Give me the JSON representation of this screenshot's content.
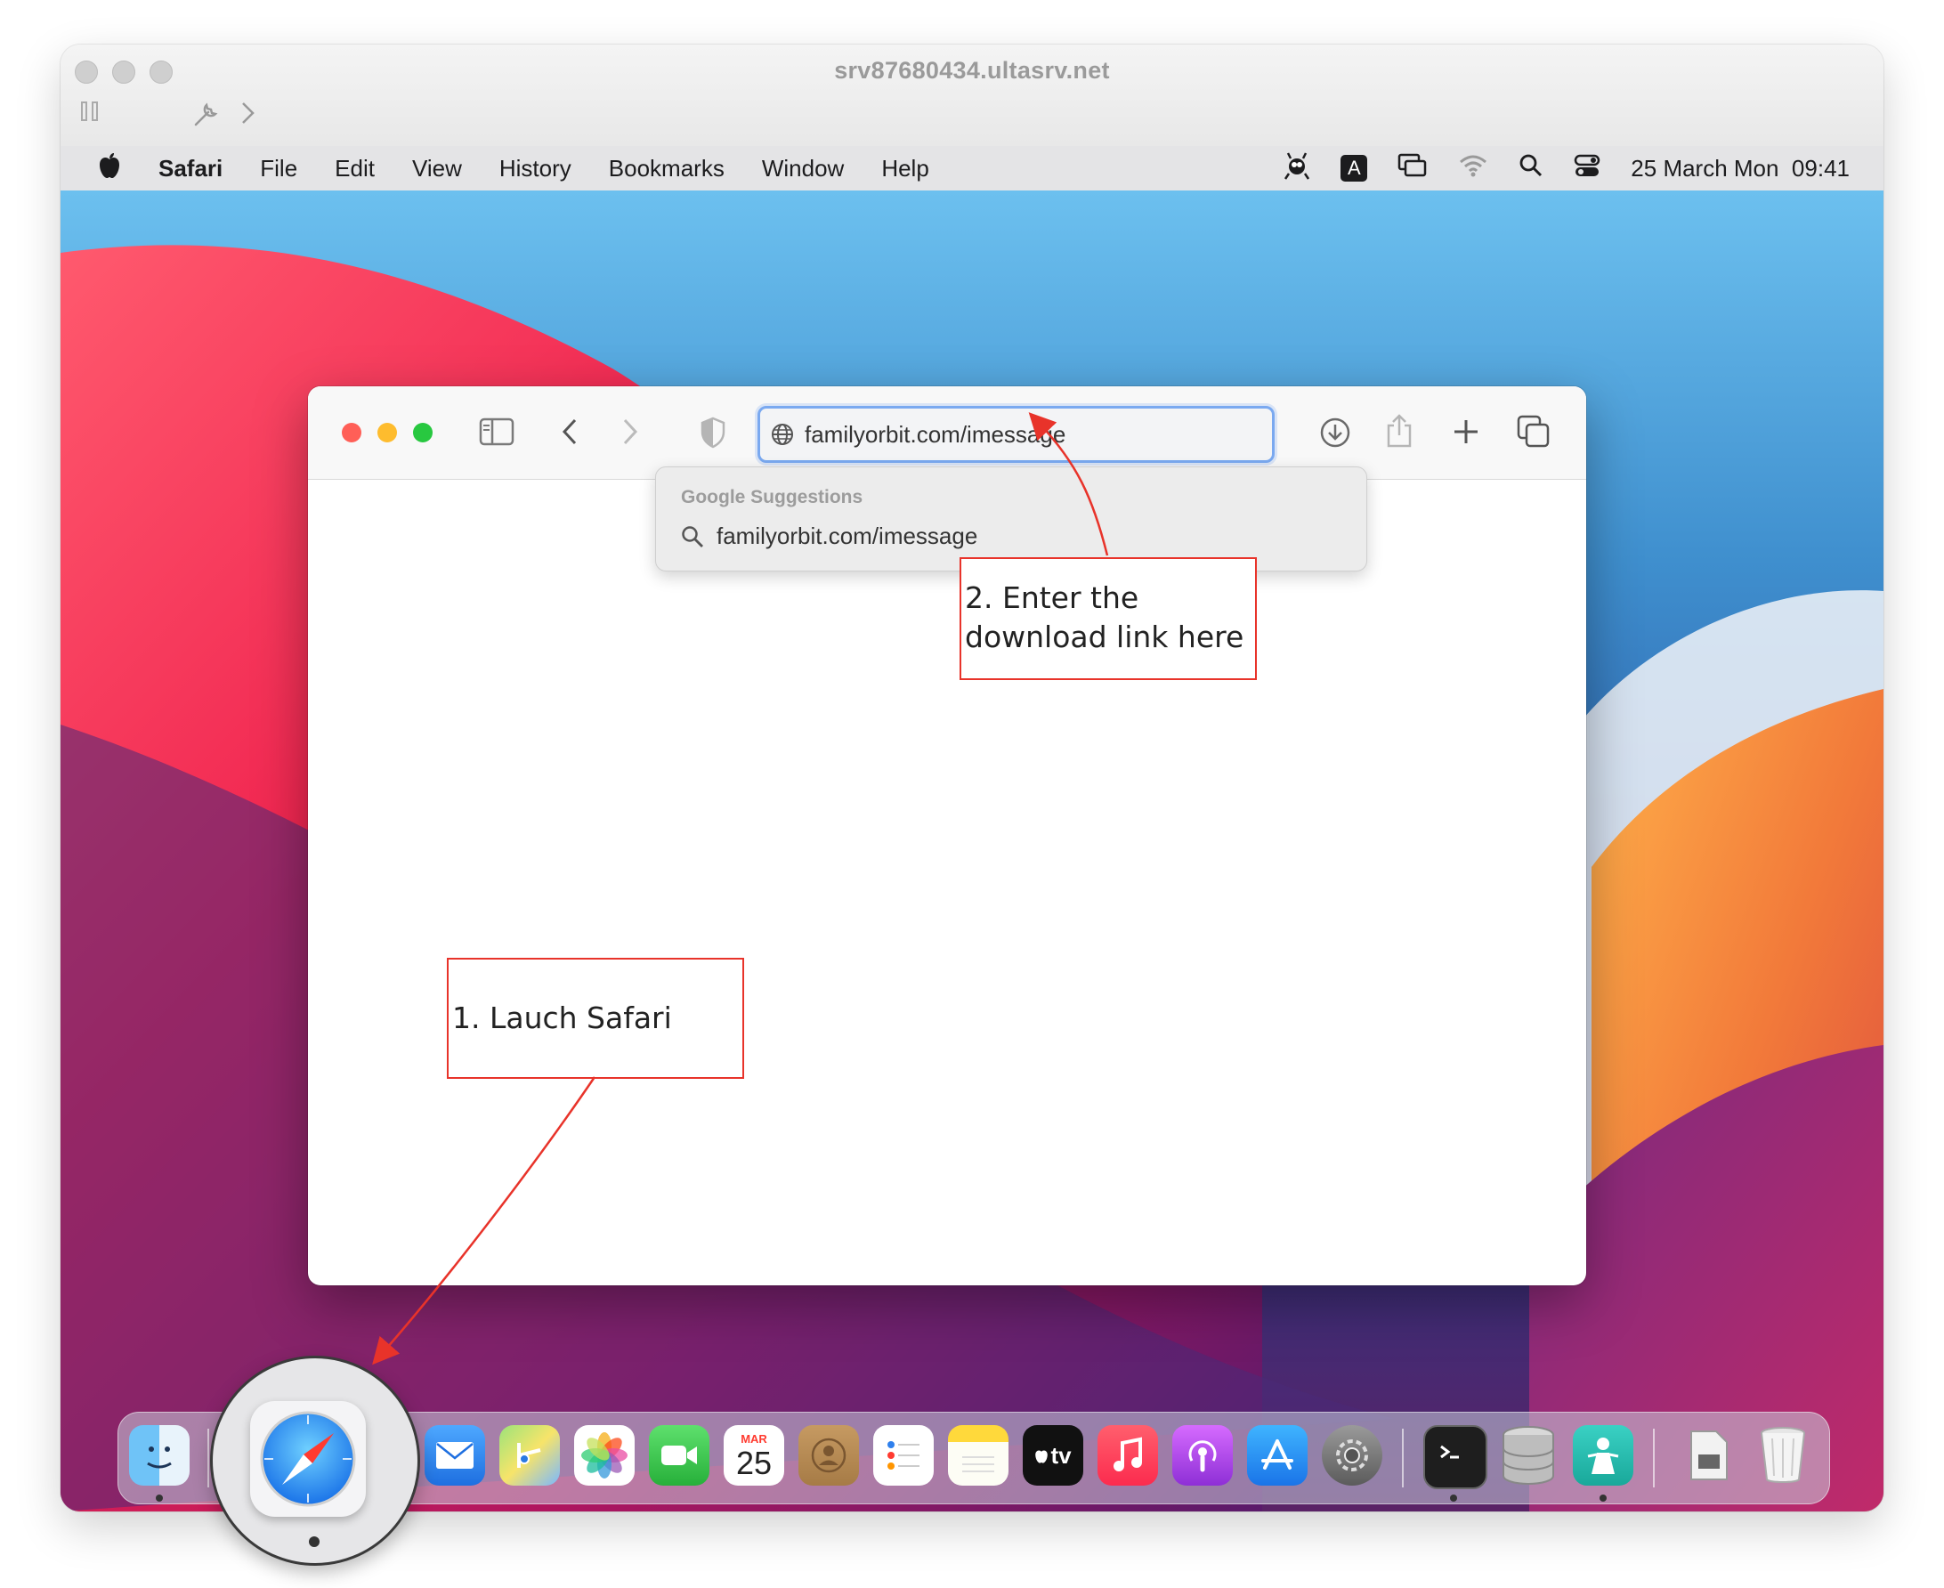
{
  "vm_window": {
    "title": "srv87680434.ultasrv.net"
  },
  "menubar": {
    "apple": "",
    "items": [
      "Safari",
      "File",
      "Edit",
      "View",
      "History",
      "Bookmarks",
      "Window",
      "Help"
    ],
    "status_icons": [
      "bug-icon",
      "input-source-icon",
      "screen-mirroring-icon",
      "wifi-icon",
      "search-icon",
      "control-center-icon"
    ],
    "input_source_label": "A",
    "clock": "25 March Mon  09:41"
  },
  "safari": {
    "url_value": "familyorbit.com/imessage",
    "suggestions": {
      "header": "Google Suggestions",
      "items": [
        "familyorbit.com/imessage"
      ]
    }
  },
  "annotations": {
    "step1": "1. Lauch Safari",
    "step2_line1": "2. Enter the",
    "step2_line2": "download link here",
    "arrow_color": "#e8332a"
  },
  "dock": {
    "calendar_month": "MAR",
    "calendar_day": "25",
    "tv_label": "tv",
    "apps": [
      "finder-icon",
      "safari-icon",
      "messages-icon",
      "mail-icon",
      "maps-icon",
      "photos-icon",
      "facetime-icon",
      "calendar-icon",
      "contacts-icon",
      "reminders-icon",
      "notes-icon",
      "apple-tv-icon",
      "music-icon",
      "podcasts-icon",
      "app-store-icon",
      "system-preferences-icon",
      "terminal-icon",
      "database-icon",
      "app-icon",
      "documents-icon",
      "trash-icon"
    ]
  }
}
